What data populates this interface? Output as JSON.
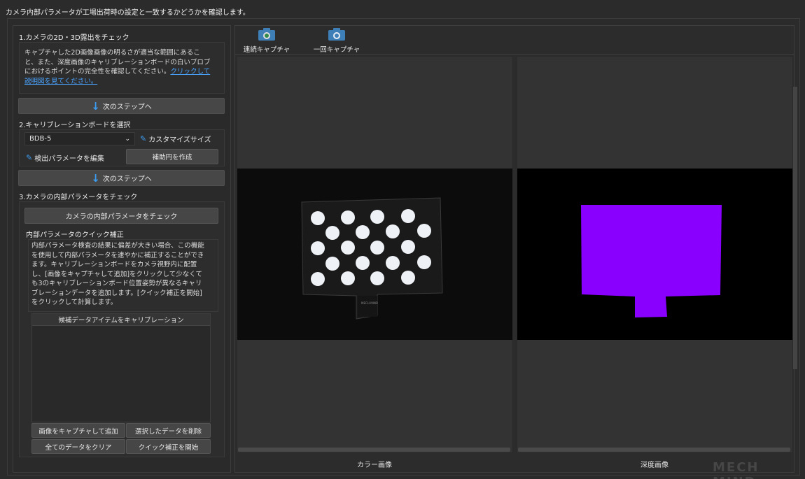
{
  "header": {
    "title": "カメラ内部パラメータが工場出荷時の設定と一致するかどうかを確認します。"
  },
  "step1": {
    "title": "1.カメラの2D・3D露出をチェック",
    "desc_lines": [
      "キャプチャした2D画像画像の明るさが適当な範囲にあるこ",
      "と、また、深度画像のキャリブレーションボードの白いブロブ",
      "におけるポイントの完全性を確認してください。"
    ],
    "link_part1": "クリックして",
    "link_part2": "説明図を見てください。",
    "next_label": "次のステップへ"
  },
  "step2": {
    "title": "2.キャリブレーションボードを選択",
    "board_value": "BDB-5",
    "custom_size_label": "カスタマイズサイズ",
    "edit_params_label": "検出パラメータを編集",
    "aux_circle_label": "補助円を作成",
    "next_label": "次のステップへ"
  },
  "step3": {
    "title": "3.カメラの内部パラメータをチェック",
    "check_button": "カメラの内部パラメータをチェック",
    "quick_title": "内部パラメータのクイック補正",
    "quick_desc_lines": [
      "内部パラメータ検査の結果に偏差が大きい場合、この機能",
      "を使用して内部パラメータを速やかに補正することができ",
      "ます。キャリブレーションボードをカメラ視野内に配置",
      "し、[画像をキャプチャして追加]をクリックして少なくて",
      "も3のキャリブレーションボード位置姿勢が異なるキャリ",
      "ブレーションデータを追加します。[クイック補正を開始]",
      "をクリックして計算します。"
    ],
    "list_header": "候補データアイテムをキャリブレーション",
    "btn_capture_add": "画像をキャプチャして追加",
    "btn_delete_selected": "選択したデータを削除",
    "btn_clear_all": "全てのデータをクリア",
    "btn_start_quick": "クイック補正を開始"
  },
  "toolbar": {
    "continuous_capture": "連続キャプチャ",
    "single_capture": "一回キャプチャ"
  },
  "views": {
    "color_label": "カラー画像",
    "depth_label": "深度画像"
  },
  "board_brand": "MECH-MIND",
  "watermark": "MECH MIND",
  "colors": {
    "accent": "#3d9cf0",
    "depth_fill": "#8a00ff",
    "link": "#4aa3ff"
  }
}
